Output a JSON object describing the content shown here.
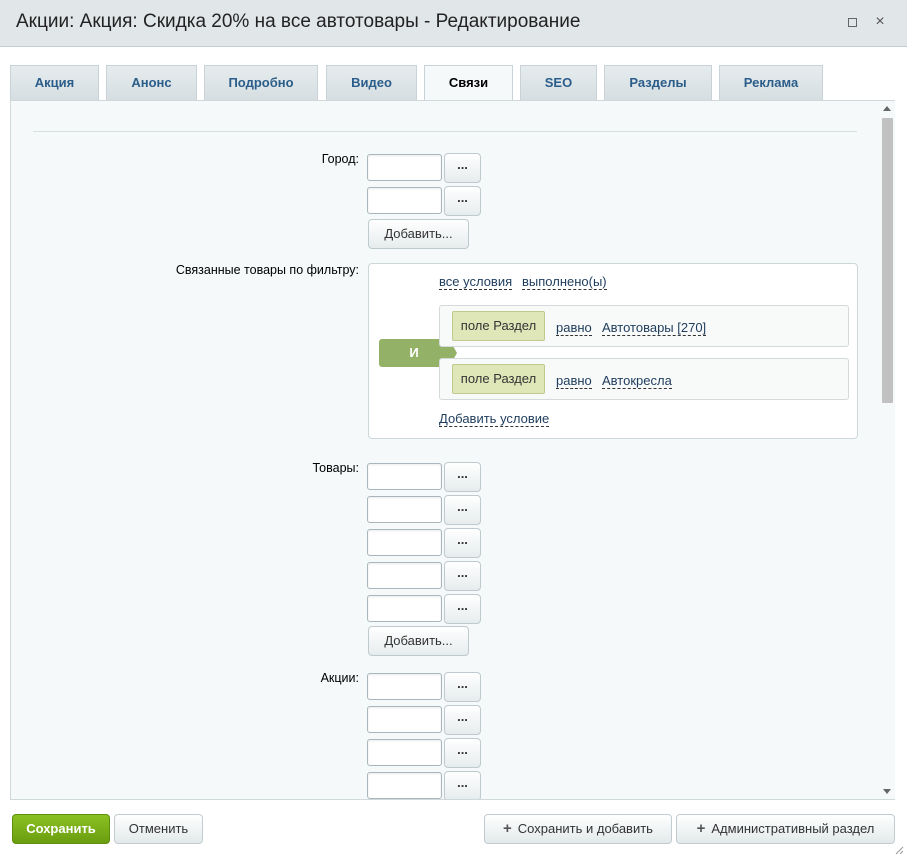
{
  "window": {
    "title": "Акции: Акция: Скидка 20% на все автотовары - Редактирование",
    "maximize_icon": "maximize-icon",
    "close_glyph": "×"
  },
  "tabs": [
    {
      "label": "Акция"
    },
    {
      "label": "Анонс"
    },
    {
      "label": "Подробно"
    },
    {
      "label": "Видео"
    },
    {
      "label": "Связи",
      "active": true
    },
    {
      "label": "SEO"
    },
    {
      "label": "Разделы"
    },
    {
      "label": "Реклама"
    }
  ],
  "form": {
    "city": {
      "label": "Город:",
      "inputs": [
        "",
        ""
      ],
      "dots": "...",
      "add_label": "Добавить..."
    },
    "filter": {
      "label": "Связанные товары по фильтру:",
      "all_conditions": "все условия",
      "fulfilled": "выполнено(ы)",
      "logic": "И",
      "conditions": [
        {
          "field": "поле Раздел",
          "op": "равно",
          "value": "Автотовары [270]"
        },
        {
          "field": "поле Раздел",
          "op": "равно",
          "value": "Автокресла"
        }
      ],
      "add_condition": "Добавить условие"
    },
    "products": {
      "label": "Товары:",
      "inputs": [
        "",
        "",
        "",
        "",
        ""
      ],
      "dots": "...",
      "add_label": "Добавить..."
    },
    "promotions": {
      "label": "Акции:",
      "inputs": [
        "",
        "",
        "",
        ""
      ],
      "dots": "..."
    }
  },
  "footer": {
    "save": "Сохранить",
    "cancel": "Отменить",
    "save_add": "Сохранить и добавить",
    "admin_section": "Административный раздел"
  },
  "colors": {
    "save_green": "#78ac16",
    "tab_text": "#2b5d8a",
    "logic_green": "#94b267",
    "field_bg": "#dfe6b8"
  }
}
